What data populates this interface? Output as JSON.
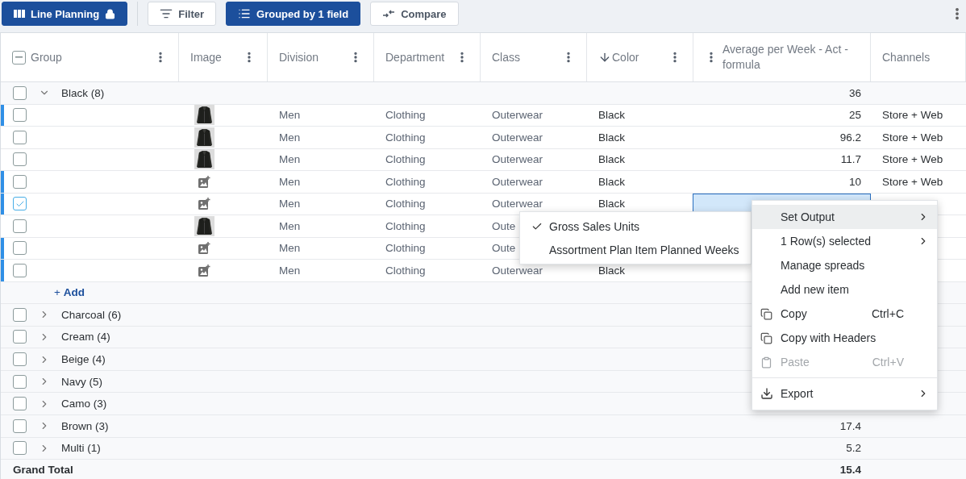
{
  "toolbar": {
    "buttons": [
      {
        "label": "Line Planning",
        "kind": "primary",
        "locked": true
      },
      {
        "label": "Filter",
        "kind": "secondary",
        "locked": false
      },
      {
        "label": "Grouped by 1 field",
        "kind": "primary",
        "locked": false
      },
      {
        "label": "Compare",
        "kind": "secondary",
        "locked": false
      }
    ]
  },
  "table": {
    "header_checkbox": {
      "indeterminate": true
    },
    "columns": [
      {
        "label": "Group",
        "kind": "text",
        "sorted": false,
        "menu": true
      },
      {
        "label": "Image",
        "kind": "text",
        "sorted": false,
        "menu": true
      },
      {
        "label": "Division",
        "kind": "text",
        "sorted": false,
        "menu": true
      },
      {
        "label": "Department",
        "kind": "text",
        "sorted": false,
        "menu": true
      },
      {
        "label": "Class",
        "kind": "text",
        "sorted": false,
        "menu": true
      },
      {
        "label": "Color",
        "kind": "text",
        "sorted": true,
        "menu": true
      },
      {
        "label": "Average per Week - Act - formula",
        "kind": "measure",
        "sorted": false,
        "menu": true
      },
      {
        "label": "Channels",
        "kind": "text",
        "sorted": false,
        "menu": false
      }
    ],
    "groups": [
      {
        "label": "Black (8)",
        "expanded": true,
        "checked": false,
        "value": "36",
        "add_label": "+ **Add**",
        "items": [
          {
            "checked": false,
            "flagged": true,
            "division": "Men",
            "department": "Clothing",
            "class": "Outerwear",
            "color_name": "Black",
            "value": "25",
            "channels": "Store + Web",
            "cell_selected": false
          },
          {
            "checked": false,
            "flagged": false,
            "division": "Men",
            "department": "Clothing",
            "class": "Outerwear",
            "color_name": "Black",
            "value": "96.2",
            "channels": "Store + Web",
            "cell_selected": false
          },
          {
            "checked": false,
            "flagged": false,
            "division": "Men",
            "department": "Clothing",
            "class": "Outerwear",
            "color_name": "Black",
            "value": "11.7",
            "channels": "Store + Web",
            "cell_selected": false
          },
          {
            "checked": false,
            "flagged": true,
            "kind": "placeholder",
            "division": "Men",
            "department": "Clothing",
            "class": "Outerwear",
            "color_name": "Black",
            "value": "10",
            "channels": "Store + Web",
            "cell_selected": false
          },
          {
            "checked": true,
            "flagged": true,
            "kind": "placeholder",
            "division": "Men",
            "department": "Clothing",
            "class": "Outerwear",
            "color_name": "Black",
            "cell_selected": true
          },
          {
            "checked": false,
            "flagged": false,
            "division": "Men",
            "department": "Clothing",
            "class": "Oute",
            "cell_selected": false
          },
          {
            "checked": false,
            "flagged": true,
            "kind": "placeholder",
            "division": "Men",
            "department": "Clothing",
            "class": "Oute",
            "cell_selected": false
          },
          {
            "checked": false,
            "flagged": true,
            "kind": "placeholder",
            "division": "Men",
            "department": "Clothing",
            "class": "Outerwear",
            "color_name": "Black",
            "cell_selected": false
          }
        ]
      },
      {
        "label": "Charcoal (6)",
        "expanded": false,
        "checked": false
      },
      {
        "label": "Cream (4)",
        "expanded": false,
        "checked": false
      },
      {
        "label": "Beige (4)",
        "expanded": false,
        "checked": false
      },
      {
        "label": "Navy (5)",
        "expanded": false,
        "checked": false
      },
      {
        "label": "Camo (3)",
        "expanded": false,
        "checked": false
      },
      {
        "label": "Brown (3)",
        "expanded": false,
        "checked": false,
        "value": "17.4"
      },
      {
        "label": "Multi (1)",
        "expanded": false,
        "checked": false,
        "value": "5.2"
      }
    ],
    "grand_total": {
      "label": "Grand Total",
      "value": "15.4"
    }
  },
  "context_menu": {
    "items": [
      {
        "label": "Set Output",
        "kind": "plain",
        "highlighted": true,
        "disabled": false,
        "submenu": true
      },
      {
        "label": "1 Row(s) selected",
        "kind": "plain",
        "highlighted": false,
        "disabled": false,
        "submenu": true
      },
      {
        "label": "Manage spreads",
        "kind": "plain",
        "highlighted": false,
        "disabled": false,
        "submenu": false
      },
      {
        "label": "Add new item",
        "kind": "plain",
        "highlighted": false,
        "disabled": false,
        "submenu": false
      },
      {
        "label": "Copy",
        "kind": "copy",
        "highlighted": false,
        "disabled": false,
        "submenu": false,
        "shortcut": "Ctrl+C"
      },
      {
        "label": "Copy with Headers",
        "kind": "copy",
        "highlighted": false,
        "disabled": false,
        "submenu": false
      },
      {
        "label": "Paste",
        "kind": "paste",
        "highlighted": false,
        "disabled": true,
        "submenu": false,
        "shortcut": "Ctrl+V"
      },
      {
        "label": "Export",
        "kind": "export",
        "highlighted": false,
        "disabled": false,
        "submenu": true,
        "divider_before": true
      }
    ]
  },
  "submenu": {
    "items": [
      {
        "label": "Gross Sales Units",
        "checked": true
      },
      {
        "label": "Assortment Plan Item Planned Weeks",
        "checked": false
      }
    ]
  }
}
